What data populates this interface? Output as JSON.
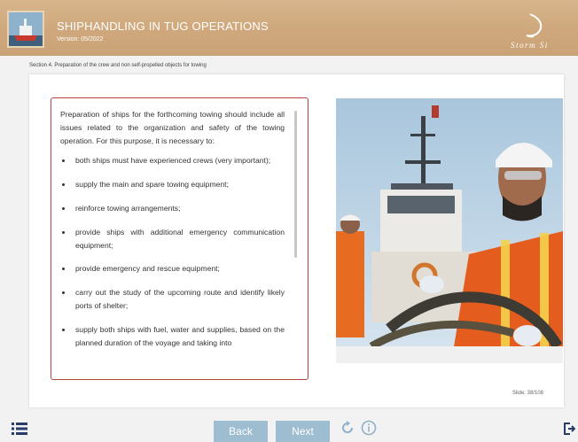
{
  "header": {
    "title": "SHIPHANDLING IN TUG OPERATIONS",
    "version": "Version: 05/2022",
    "logo_text": "Storm Si"
  },
  "section": {
    "title": "Section 4. Preparation of the crew and non self-propelled objects for towing"
  },
  "content": {
    "intro": "Preparation of ships for the forthcoming towing should include all issues related to the organization and safety of the towing operation. For this purpose, it is necessary to:",
    "bullets": [
      "both ships must have experienced crews (very important);",
      "supply the main and spare towing equipment;",
      "reinforce towing arrangements;",
      "provide ships with additional emergency communication equipment;",
      "provide emergency and rescue equipment;",
      "carry out the study of the upcoming route and identify likely ports of shelter;",
      "supply both ships with fuel, water and supplies, based on the planned duration of the voyage and taking into"
    ]
  },
  "slide": {
    "label": "Slide: 38/108"
  },
  "nav": {
    "back_label": "Back",
    "next_label": "Next"
  },
  "colors": {
    "accent": "#9fbdd0",
    "header": "#cfa97d",
    "border": "#b3433f"
  },
  "icons": [
    "menu-icon",
    "replay-icon",
    "info-icon",
    "exit-icon"
  ]
}
